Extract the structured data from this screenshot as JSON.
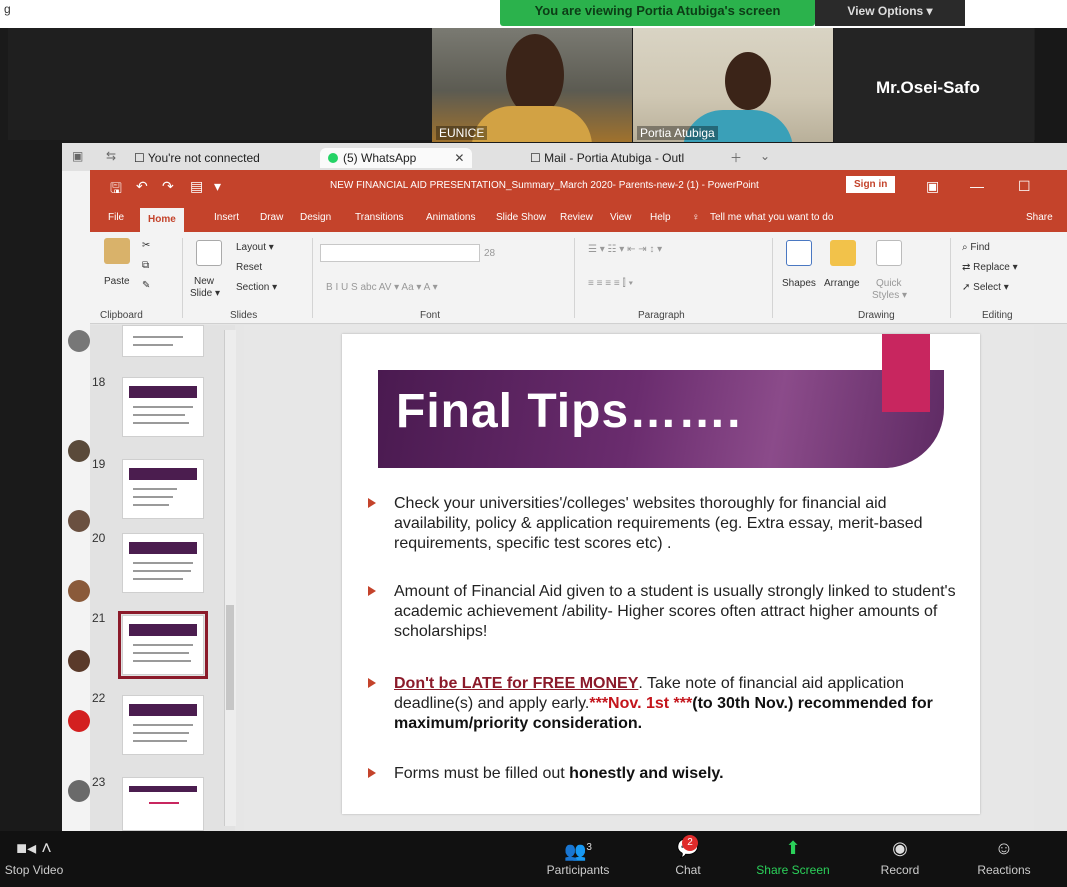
{
  "top": {
    "corner_glyph": "g",
    "banner": "You are viewing Portia Atubiga's screen",
    "view_options": "View Options ▾"
  },
  "participants": {
    "tile1_name": "EUNICE",
    "tile2_name": "Portia Atubiga",
    "tile3_name": "Mr.Osei-Safo"
  },
  "browser_tabs": [
    {
      "label": "You're not connected"
    },
    {
      "label": "(5) WhatsApp"
    },
    {
      "label": "Mail - Portia Atubiga - Outl"
    }
  ],
  "ppt": {
    "doc_title": "NEW FINANCIAL AID PRESENTATION_Summary_March 2020- Parents-new-2 (1) - PowerPoint",
    "sign_in": "Sign in",
    "menu": [
      "File",
      "Home",
      "Insert",
      "Draw",
      "Design",
      "Transitions",
      "Animations",
      "Slide Show",
      "Review",
      "View",
      "Help",
      "Tell me what you want to do",
      "Share"
    ],
    "ribbon": {
      "paste": "Paste",
      "new_slide": "New",
      "new_slide2": "Slide ▾",
      "layout": "Layout ▾",
      "reset": "Reset",
      "section": "Section ▾",
      "shapes": "Shapes",
      "arrange": "Arrange",
      "quick_styles": "Quick",
      "quick_styles2": "Styles ▾",
      "find": "Find",
      "replace": "Replace ▾",
      "select": "Select ▾",
      "font_size": "28"
    },
    "groups": [
      "Clipboard",
      "Slides",
      "Font",
      "Paragraph",
      "Drawing",
      "Editing"
    ]
  },
  "thumbnails": [
    {
      "num": "18"
    },
    {
      "num": "19"
    },
    {
      "num": "20"
    },
    {
      "num": "21"
    },
    {
      "num": "22"
    },
    {
      "num": "23"
    }
  ],
  "slide": {
    "title": "Final Tips…….",
    "b1": "Check your universities'/colleges' websites thoroughly for financial aid availability, policy & application requirements (eg. Extra essay, merit-based requirements, specific test scores etc) .",
    "b2": "Amount of Financial Aid given to a student is usually strongly linked to student's academic achievement /ability- Higher scores often attract higher amounts of scholarships!",
    "b3_u": "Don't be LATE for FREE MONEY",
    "b3_a": ". Take note of financial aid application deadline(s) and apply early.",
    "b3_red": "***Nov. 1st ***",
    "b3_dark": "(to 30th Nov.) recommended for maximum/priority consideration.",
    "b4_a": "Forms must be filled out ",
    "b4_b": "honestly and wisely."
  },
  "bottom": {
    "stop_video": "Stop Video",
    "participants": "Participants",
    "participants_count": "3",
    "chat": "Chat",
    "chat_badge": "2",
    "share": "Share Screen",
    "record": "Record",
    "reactions": "Reactions"
  },
  "colors": {
    "ppt_red": "#c4432b",
    "slide_purple": "#4a1a50",
    "accent_pink": "#c8265f",
    "zoom_green": "#2bb24c"
  }
}
